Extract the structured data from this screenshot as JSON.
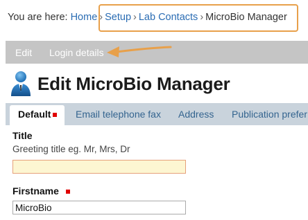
{
  "breadcrumb": {
    "prefix": "You are here:",
    "home": "Home",
    "setup": "Setup",
    "lab_contacts": "Lab Contacts",
    "current": "MicroBio Manager",
    "separator": "›"
  },
  "subnav": {
    "edit": "Edit",
    "login_details": "Login details"
  },
  "page": {
    "title": "Edit MicroBio Manager"
  },
  "tabs": [
    {
      "label": "Default"
    },
    {
      "label": "Email telephone fax"
    },
    {
      "label": "Address"
    },
    {
      "label": "Publication prefer"
    }
  ],
  "form": {
    "title_label": "Title",
    "title_hint": "Greeting title eg. Mr, Mrs, Dr",
    "title_value": "",
    "firstname_label": "Firstname",
    "firstname_value": "MicroBio"
  },
  "colors": {
    "annotation": "#e8a04a",
    "required": "#e00000",
    "link": "#2a6cb3"
  }
}
